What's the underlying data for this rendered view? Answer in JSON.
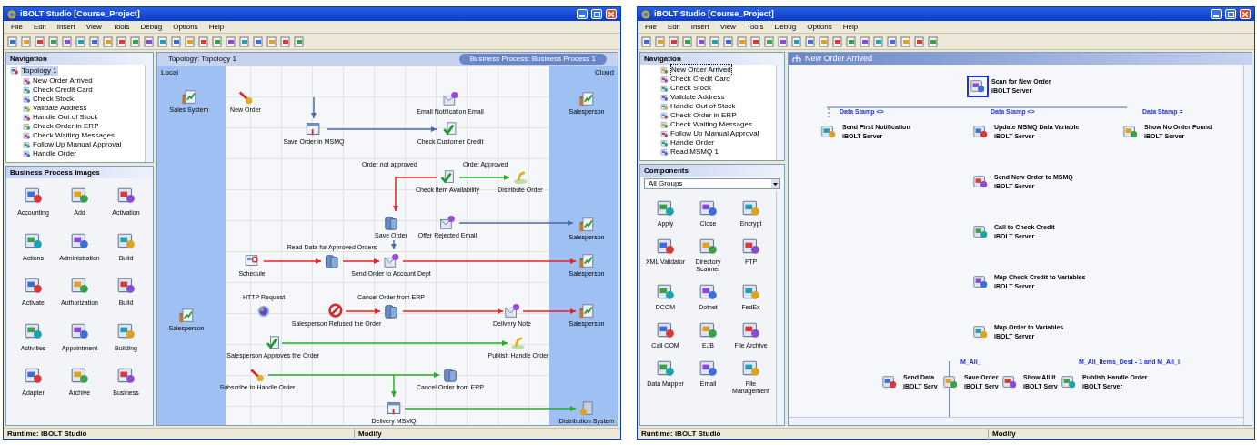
{
  "left_window": {
    "title": "iBOLT Studio [Course_Project]",
    "menu": [
      "File",
      "Edit",
      "Insert",
      "View",
      "Tools",
      "Debug",
      "Options",
      "Help"
    ],
    "navigation": {
      "title": "Navigation",
      "tree": [
        {
          "label": "Topology 1",
          "selected": true,
          "children": [
            {
              "label": "New Order Arrived",
              "selected": false
            },
            {
              "label": "Check Credit Card",
              "selected": false
            },
            {
              "label": "Check Stock",
              "selected": false
            },
            {
              "label": "Validate Address",
              "selected": false
            },
            {
              "label": "Handle Out of Stock",
              "selected": false
            },
            {
              "label": "Check Order in ERP",
              "selected": false
            },
            {
              "label": "Check Waiting Messages",
              "selected": false
            },
            {
              "label": "Follow Up Manual Approval",
              "selected": false
            },
            {
              "label": "Handle Order",
              "selected": false
            }
          ]
        }
      ]
    },
    "images": {
      "title": "Business Process Images",
      "items": [
        "Accounting",
        "Add",
        "Activation",
        "Actions",
        "Administration",
        "Build",
        "Activate",
        "Authorization",
        "Build",
        "Activities",
        "Appointment",
        "Building",
        "Adapter",
        "Archive",
        "Business"
      ]
    },
    "tabs": [
      {
        "label": "Topology: Topology 1",
        "selected": false
      },
      {
        "label": "Business Process: Business Process 1",
        "selected": true
      }
    ],
    "lanes": [
      "Local",
      "Cloud"
    ],
    "nodes": [
      {
        "label": "Sales System",
        "kind": "system"
      },
      {
        "label": "New Order",
        "kind": "trigger"
      },
      {
        "label": "Save Order in MSMQ",
        "kind": "msmq"
      },
      {
        "label": "Email Notification Email",
        "kind": "email"
      },
      {
        "label": "Check Customer Credit",
        "kind": "check"
      },
      {
        "label": "Check Item Availability",
        "kind": "check"
      },
      {
        "label": "Distribute Order",
        "kind": "publish"
      },
      {
        "label": "Save Order",
        "kind": "database"
      },
      {
        "label": "Offer Rejected Email",
        "kind": "email"
      },
      {
        "label": "Salesperson",
        "kind": "system"
      },
      {
        "label": "Salesperson",
        "kind": "system"
      },
      {
        "label": "Schedule",
        "kind": "schedule"
      },
      {
        "label": "Read Data for Approved Orders",
        "kind": "database"
      },
      {
        "label": "Send Order to Account Dept",
        "kind": "email"
      },
      {
        "label": "Salesperson",
        "kind": "system"
      },
      {
        "label": "Salesperson",
        "kind": "system"
      },
      {
        "label": "HTTP Request",
        "kind": "http"
      },
      {
        "label": "Salesperson Refused the Order",
        "kind": "refuse"
      },
      {
        "label": "Cancel Order from ERP",
        "kind": "database"
      },
      {
        "label": "Delivery Note",
        "kind": "email"
      },
      {
        "label": "Salesperson",
        "kind": "system"
      },
      {
        "label": "Salesperson Approves the Order",
        "kind": "approve"
      },
      {
        "label": "Publish Handle Order",
        "kind": "publish"
      },
      {
        "label": "Subscribe to Handle Order",
        "kind": "trigger"
      },
      {
        "label": "Cancel Order from ERP",
        "kind": "database"
      },
      {
        "label": "Delivery MSMQ",
        "kind": "msmq"
      },
      {
        "label": "Distribution System",
        "kind": "server"
      }
    ],
    "flow_labels": [
      "Order not approved",
      "Order Approved"
    ],
    "status_bar": [
      "Runtime: iBOLT Studio",
      "Modify"
    ]
  },
  "right_window": {
    "title": "iBOLT Studio [Course_Project]",
    "menu": [
      "File",
      "Edit",
      "Insert",
      "View",
      "Tools",
      "Debug",
      "Options",
      "Help"
    ],
    "navigation": {
      "title": "Navigation",
      "items": [
        {
          "label": "New Order Arrived",
          "selected": true
        },
        {
          "label": "Check Credit Card",
          "selected": false
        },
        {
          "label": "Check Stock",
          "selected": false
        },
        {
          "label": "Validate Address",
          "selected": false
        },
        {
          "label": "Handle Out of Stock",
          "selected": false
        },
        {
          "label": "Check Order in ERP",
          "selected": false
        },
        {
          "label": "Check Waiting Messages",
          "selected": false
        },
        {
          "label": "Follow Up Manual Approval",
          "selected": false
        },
        {
          "label": "Handle Order",
          "selected": false
        },
        {
          "label": "Read MSMQ 1",
          "selected": false
        }
      ]
    },
    "components": {
      "title": "Components",
      "group": "All Groups",
      "items": [
        "Apply",
        "Close",
        "Encrypt",
        "XML Validator",
        "Directory Scanner",
        "FTP",
        "DCOM",
        "Dotnet",
        "FedEx",
        "Call COM",
        "EJB",
        "File Archive",
        "Data Mapper",
        "Email",
        "File Management"
      ]
    },
    "flow": {
      "title": "New Order Arrived",
      "steps": [
        {
          "name": "Scan for New Order",
          "server": "iBOLT Server",
          "selected": true
        },
        {
          "name": "Send First Notification",
          "server": "iBOLT Server",
          "selected": false
        },
        {
          "name": "Update MSMQ Data Variable",
          "server": "iBOLT Server",
          "selected": false
        },
        {
          "name": "Show No Order Found",
          "server": "iBOLT Server",
          "selected": false
        },
        {
          "name": "Send New Order to MSMQ",
          "server": "iBOLT Server",
          "selected": false
        },
        {
          "name": "Call to Check Credit",
          "server": "iBOLT Server",
          "selected": false
        },
        {
          "name": "Map Check Credit to Variables",
          "server": "iBOLT Server",
          "selected": false
        },
        {
          "name": "Map Order to Variables",
          "server": "iBOLT Server",
          "selected": false
        },
        {
          "name": "Send Data",
          "server": "iBOLT Serv",
          "selected": false
        },
        {
          "name": "Save Order",
          "server": "iBOLT Serv",
          "selected": false
        },
        {
          "name": "Show All It",
          "server": "iBOLT Serv",
          "selected": false
        },
        {
          "name": "Publish Handle Order",
          "server": "iBOLT Server",
          "selected": false
        }
      ],
      "branch_labels": [
        "Data Stamp <>",
        "Data Stamp <>",
        "Data Stamp =",
        "M_All_",
        "M_All_Items_Dest - 1 and M_All_I"
      ]
    },
    "status_bar": [
      "Runtime: iBOLT Studio",
      "Modify"
    ]
  }
}
